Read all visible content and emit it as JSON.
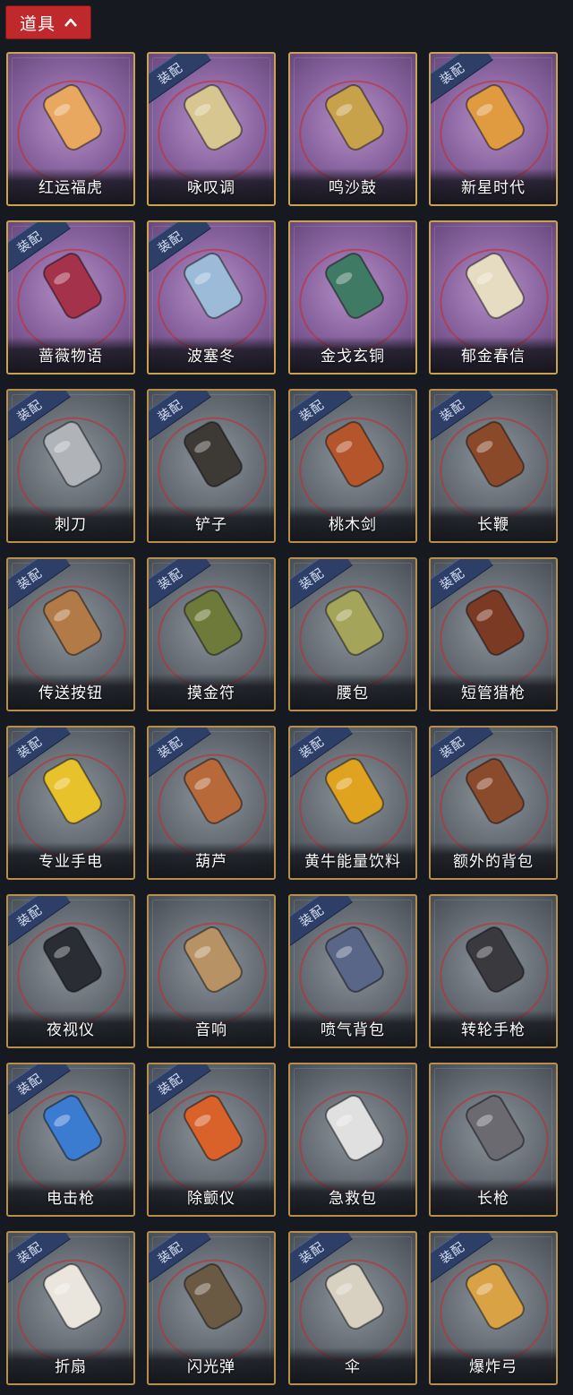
{
  "header": {
    "label": "道具",
    "chevron_icon": "chevron-up-icon",
    "background": "#c0292b"
  },
  "items": [
    {
      "name": "红运福虎",
      "style": "purple",
      "equipped": false,
      "icon": "tiger-plush-icon",
      "tint": "#e8a860"
    },
    {
      "name": "咏叹调",
      "style": "purple",
      "equipped": true,
      "icon": "birdcage-icon",
      "tint": "#d8c690"
    },
    {
      "name": "鸣沙鼓",
      "style": "purple",
      "equipped": false,
      "icon": "hand-drum-icon",
      "tint": "#c7a24a"
    },
    {
      "name": "新星时代",
      "style": "purple",
      "equipped": true,
      "icon": "revolver-ornate-icon",
      "tint": "#e09a40"
    },
    {
      "name": "蔷薇物语",
      "style": "purple",
      "equipped": true,
      "icon": "rose-medkit-icon",
      "tint": "#a3324a"
    },
    {
      "name": "波塞冬",
      "style": "purple",
      "equipped": true,
      "icon": "trident-staff-icon",
      "tint": "#9bbbd8"
    },
    {
      "name": "金戈玄铜",
      "style": "purple",
      "equipped": false,
      "icon": "bronze-grenade-icon",
      "tint": "#3f7a64"
    },
    {
      "name": "郁金春信",
      "style": "purple",
      "equipped": false,
      "icon": "paper-umbrella-icon",
      "tint": "#e6dcc2"
    },
    {
      "name": "刺刀",
      "style": "gray",
      "equipped": true,
      "icon": "bayonet-icon",
      "tint": "#b0b4b8"
    },
    {
      "name": "铲子",
      "style": "gray",
      "equipped": true,
      "icon": "shovel-icon",
      "tint": "#3d3a36"
    },
    {
      "name": "桃木剑",
      "style": "gray",
      "equipped": true,
      "icon": "wooden-sword-icon",
      "tint": "#b5552c"
    },
    {
      "name": "长鞭",
      "style": "gray",
      "equipped": true,
      "icon": "whip-icon",
      "tint": "#8a4a2a"
    },
    {
      "name": "传送按钮",
      "style": "gray",
      "equipped": true,
      "icon": "teleport-button-icon",
      "tint": "#b27a46"
    },
    {
      "name": "摸金符",
      "style": "gray",
      "equipped": true,
      "icon": "talisman-tooth-icon",
      "tint": "#6d7a3a"
    },
    {
      "name": "腰包",
      "style": "gray",
      "equipped": true,
      "icon": "waist-bag-icon",
      "tint": "#a4a45a"
    },
    {
      "name": "短管猎枪",
      "style": "gray",
      "equipped": true,
      "icon": "sawed-off-shotgun-icon",
      "tint": "#7a3a24"
    },
    {
      "name": "专业手电",
      "style": "gray",
      "equipped": true,
      "icon": "flashlight-icon",
      "tint": "#e8c22a"
    },
    {
      "name": "葫芦",
      "style": "gray",
      "equipped": true,
      "icon": "gourd-icon",
      "tint": "#b7693a"
    },
    {
      "name": "黄牛能量饮料",
      "style": "gray",
      "equipped": true,
      "icon": "energy-drink-icon",
      "tint": "#e0a320"
    },
    {
      "name": "额外的背包",
      "style": "gray",
      "equipped": true,
      "icon": "backpack-icon",
      "tint": "#8a4a2c"
    },
    {
      "name": "夜视仪",
      "style": "gray",
      "equipped": true,
      "icon": "night-vision-goggles-icon",
      "tint": "#2a2e34"
    },
    {
      "name": "音响",
      "style": "gray",
      "equipped": false,
      "icon": "radio-speaker-icon",
      "tint": "#b79264"
    },
    {
      "name": "喷气背包",
      "style": "gray",
      "equipped": true,
      "icon": "jetpack-icon",
      "tint": "#5a6688"
    },
    {
      "name": "转轮手枪",
      "style": "gray",
      "equipped": false,
      "icon": "revolver-icon",
      "tint": "#3a3a3e"
    },
    {
      "name": "电击枪",
      "style": "gray",
      "equipped": true,
      "icon": "stun-gun-icon",
      "tint": "#3b7bd0"
    },
    {
      "name": "除颤仪",
      "style": "gray",
      "equipped": true,
      "icon": "defibrillator-icon",
      "tint": "#d8622a"
    },
    {
      "name": "急救包",
      "style": "gray",
      "equipped": false,
      "icon": "first-aid-kit-icon",
      "tint": "#e0e0e0"
    },
    {
      "name": "长枪",
      "style": "gray",
      "equipped": false,
      "icon": "spear-icon",
      "tint": "#6a6a70"
    },
    {
      "name": "折扇",
      "style": "gray",
      "equipped": true,
      "icon": "folding-fan-icon",
      "tint": "#eae6de"
    },
    {
      "name": "闪光弹",
      "style": "gray",
      "equipped": true,
      "icon": "flashbang-icon",
      "tint": "#6a5a44"
    },
    {
      "name": "伞",
      "style": "gray",
      "equipped": true,
      "icon": "umbrella-icon",
      "tint": "#d8d0c0"
    },
    {
      "name": "爆炸弓",
      "style": "gray",
      "equipped": true,
      "icon": "explosive-bow-icon",
      "tint": "#d9a244"
    }
  ],
  "equip_badge_label": "装配"
}
